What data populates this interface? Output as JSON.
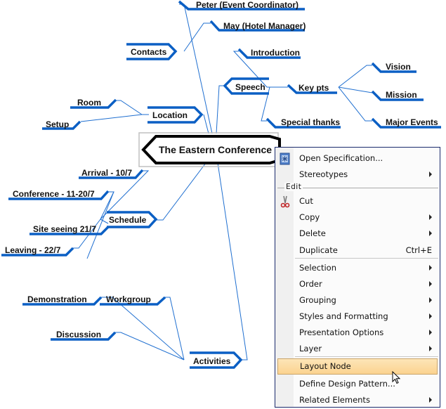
{
  "diagram": {
    "root": "The Eastern Conference",
    "branches": [
      {
        "label": "Contacts",
        "children": [
          "Peter (Event Coordinator)",
          "May (Hotel Manager)"
        ]
      },
      {
        "label": "Location",
        "children": [
          "Room",
          "Setup"
        ]
      },
      {
        "label": "Speech",
        "children": [
          "Introduction",
          {
            "label": "Key pts",
            "children": [
              "Vision",
              "Mission",
              "Major Events"
            ]
          },
          "Special thanks"
        ]
      },
      {
        "label": "Schedule",
        "children": [
          "Arrival - 10/7",
          "Conference - 11-20/7",
          "Site seeing 21/7",
          "Leaving - 22/7"
        ]
      },
      {
        "label": "Activities",
        "children": [
          {
            "label": "Workgroup",
            "children": [
              "Demonstration"
            ]
          },
          "Discussion"
        ]
      }
    ],
    "labels": {
      "root": "The Eastern Conference",
      "contacts": "Contacts",
      "peter": "Peter (Event Coordinator)",
      "may": "May (Hotel Manager)",
      "location": "Location",
      "room": "Room",
      "setup": "Setup",
      "speech": "Speech",
      "introduction": "Introduction",
      "keypts": "Key pts",
      "vision": "Vision",
      "mission": "Mission",
      "major_events": "Major Events",
      "special_thanks": "Special thanks",
      "schedule": "Schedule",
      "arrival": "Arrival - 10/7",
      "conference": "Conference - 11-20/7",
      "site_seeing": "Site seeing 21/7",
      "leaving": "Leaving - 22/7",
      "activities": "Activities",
      "workgroup": "Workgroup",
      "demonstration": "Demonstration",
      "discussion": "Discussion"
    },
    "colors": {
      "branch": "#0b5fc4",
      "connector": "#1f6fd0",
      "root_border": "#000000",
      "selection": "#c0c0c0"
    }
  },
  "context_menu": {
    "items": [
      {
        "label": "Open Specification...",
        "icon": "specification-icon",
        "submenu": false
      },
      {
        "label": "Stereotypes",
        "submenu": true
      },
      {
        "section": "Edit"
      },
      {
        "label": "Cut",
        "icon": "scissors-icon",
        "submenu": false
      },
      {
        "label": "Copy",
        "submenu": true
      },
      {
        "label": "Delete",
        "submenu": true
      },
      {
        "label": "Duplicate",
        "shortcut": "Ctrl+E",
        "submenu": false
      },
      {
        "label": "Selection",
        "submenu": true
      },
      {
        "label": "Order",
        "submenu": true
      },
      {
        "label": "Grouping",
        "submenu": true
      },
      {
        "label": "Styles and Formatting",
        "submenu": true
      },
      {
        "label": "Presentation Options",
        "submenu": true
      },
      {
        "label": "Layer",
        "submenu": true
      },
      {
        "label": "Layout Node",
        "submenu": false,
        "highlighted": true
      },
      {
        "label": "Define Design Pattern...",
        "submenu": false
      },
      {
        "label": "Related Elements",
        "submenu": true
      }
    ],
    "highlight_color": "#fcd89a"
  }
}
